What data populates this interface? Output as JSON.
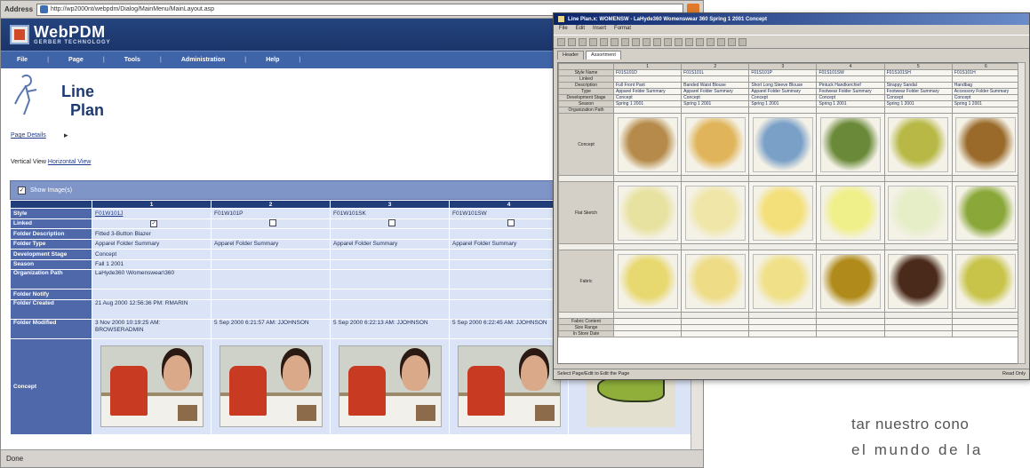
{
  "browser": {
    "address_label": "Address",
    "url": "http://wp2000nt/webpdm/Dialog/MainMenu/MainLayout.asp",
    "status": "Done"
  },
  "webpdm": {
    "logo_title": "WebPDM",
    "logo_subtitle": "GERBER TECHNOLOGY",
    "menu": [
      "File",
      "Page",
      "Tools",
      "Administration",
      "Help"
    ],
    "page_title_line1": "Line",
    "page_title_line2": "Plan",
    "page_details": "Page Details",
    "view_label": "Vertical View",
    "view_link": "Horizontal View",
    "show_images": "Show Image(s)"
  },
  "line_plan_table": {
    "columns": [
      "1",
      "2",
      "3",
      "4"
    ],
    "rows": [
      {
        "label": "Style",
        "values": [
          "F01W101J",
          "F01W101P",
          "F01W101SK",
          "F01W101SW"
        ]
      },
      {
        "label": "Linked",
        "values": [
          "checked",
          "unchecked",
          "unchecked",
          "unchecked"
        ]
      },
      {
        "label": "Folder Description",
        "values": [
          "Fitted 3-Button Blazer",
          "",
          "",
          ""
        ]
      },
      {
        "label": "Folder Type",
        "values": [
          "Apparel Folder Summary",
          "Apparel Folder Summary",
          "Apparel Folder Summary",
          "Apparel Folder Summary"
        ]
      },
      {
        "label": "Development Stage",
        "values": [
          "Concept",
          "",
          "",
          ""
        ]
      },
      {
        "label": "Season",
        "values": [
          "Fall 1 2001",
          "",
          "",
          ""
        ]
      },
      {
        "label": "Organization Path",
        "values": [
          "LaHyde360 \\Womenswear\\360",
          "",
          "",
          ""
        ]
      },
      {
        "label": "Folder Notify",
        "values": [
          "",
          "",
          "",
          ""
        ]
      },
      {
        "label": "Folder Created",
        "values": [
          "21 Aug 2000 12:56:36 PM: RMARIN",
          "",
          "",
          ""
        ]
      },
      {
        "label": "Folder Modified",
        "values": [
          "3 Nov 2000 10:19:25 AM: BROWSERADMIN",
          "5 Sep 2000 6:21:57 AM: JJOHNSON",
          "5 Sep 2000 6:22:13 AM: JJOHNSON",
          "5 Sep 2000 6:22:45 AM: JJOHNSON"
        ]
      },
      {
        "label": "Concept",
        "values": [
          "",
          "",
          "",
          ""
        ]
      }
    ]
  },
  "app_window": {
    "title": "Line Plan.x: WOMENSW - LaHyde360 Womenswear 360 Spring 1 2001 Concept",
    "menu": [
      "File",
      "Edit",
      "Insert",
      "Format"
    ],
    "tabs": [
      "Header",
      "Assortment"
    ],
    "grid_columns": [
      "1",
      "2",
      "3",
      "4",
      "5",
      "6"
    ],
    "grid_rows": [
      {
        "label": "Style Name",
        "values": [
          "F01S101D",
          "F01S101L",
          "F01S101P",
          "F01S101SW",
          "F01S101SH",
          "F01S101H"
        ]
      },
      {
        "label": "Linked",
        "values": [
          "",
          "",
          "",
          "",
          "",
          ""
        ]
      },
      {
        "label": "Description",
        "values": [
          "Full Front Pant",
          "Banded Waist Blouse",
          "Short Long Sleeve Blouse",
          "Pintuck Handkerchief",
          "Strappy Sandal",
          "Handbag"
        ]
      },
      {
        "label": "Type",
        "values": [
          "Apparel Folder Summary",
          "Apparel Folder Summary",
          "Apparel Folder Summary",
          "Footwear Folder Summary",
          "Footwear Folder Summary",
          "Accessory Folder Summary"
        ]
      },
      {
        "label": "Development Stage",
        "values": [
          "Concept",
          "Concept",
          "Concept",
          "Concept",
          "Concept",
          "Concept"
        ]
      },
      {
        "label": "Season",
        "values": [
          "Spring 1 2001",
          "Spring 1 2001",
          "Spring 1 2001",
          "Spring 1 2001",
          "Spring 1 2001",
          "Spring 1 2001"
        ]
      },
      {
        "label": "Organization Path",
        "values": [
          "",
          "",
          "",
          "",
          "",
          ""
        ]
      }
    ],
    "image_rows": [
      "Concept",
      "Flat Sketch",
      "Fabric"
    ],
    "bottom_rows": [
      {
        "label": "Fabric Content",
        "values": [
          "",
          "",
          "",
          "",
          "",
          ""
        ]
      },
      {
        "label": "Size Range",
        "values": [
          "",
          "",
          "",
          "",
          "",
          ""
        ]
      },
      {
        "label": "In Store Date",
        "values": [
          "",
          "",
          "",
          "",
          "",
          ""
        ]
      }
    ],
    "status_left": "Select Page/Edit to Edit the Page",
    "status_right": "Read Only"
  },
  "article_text": {
    "line1": "tar nuestro cono",
    "line2": "el mundo de la"
  },
  "colors": {
    "header_navy": "#1b356a",
    "menu_blue": "#3f64a8",
    "row_head_blue": "#4f68a9",
    "cell_blue": "#dbe4f6"
  }
}
